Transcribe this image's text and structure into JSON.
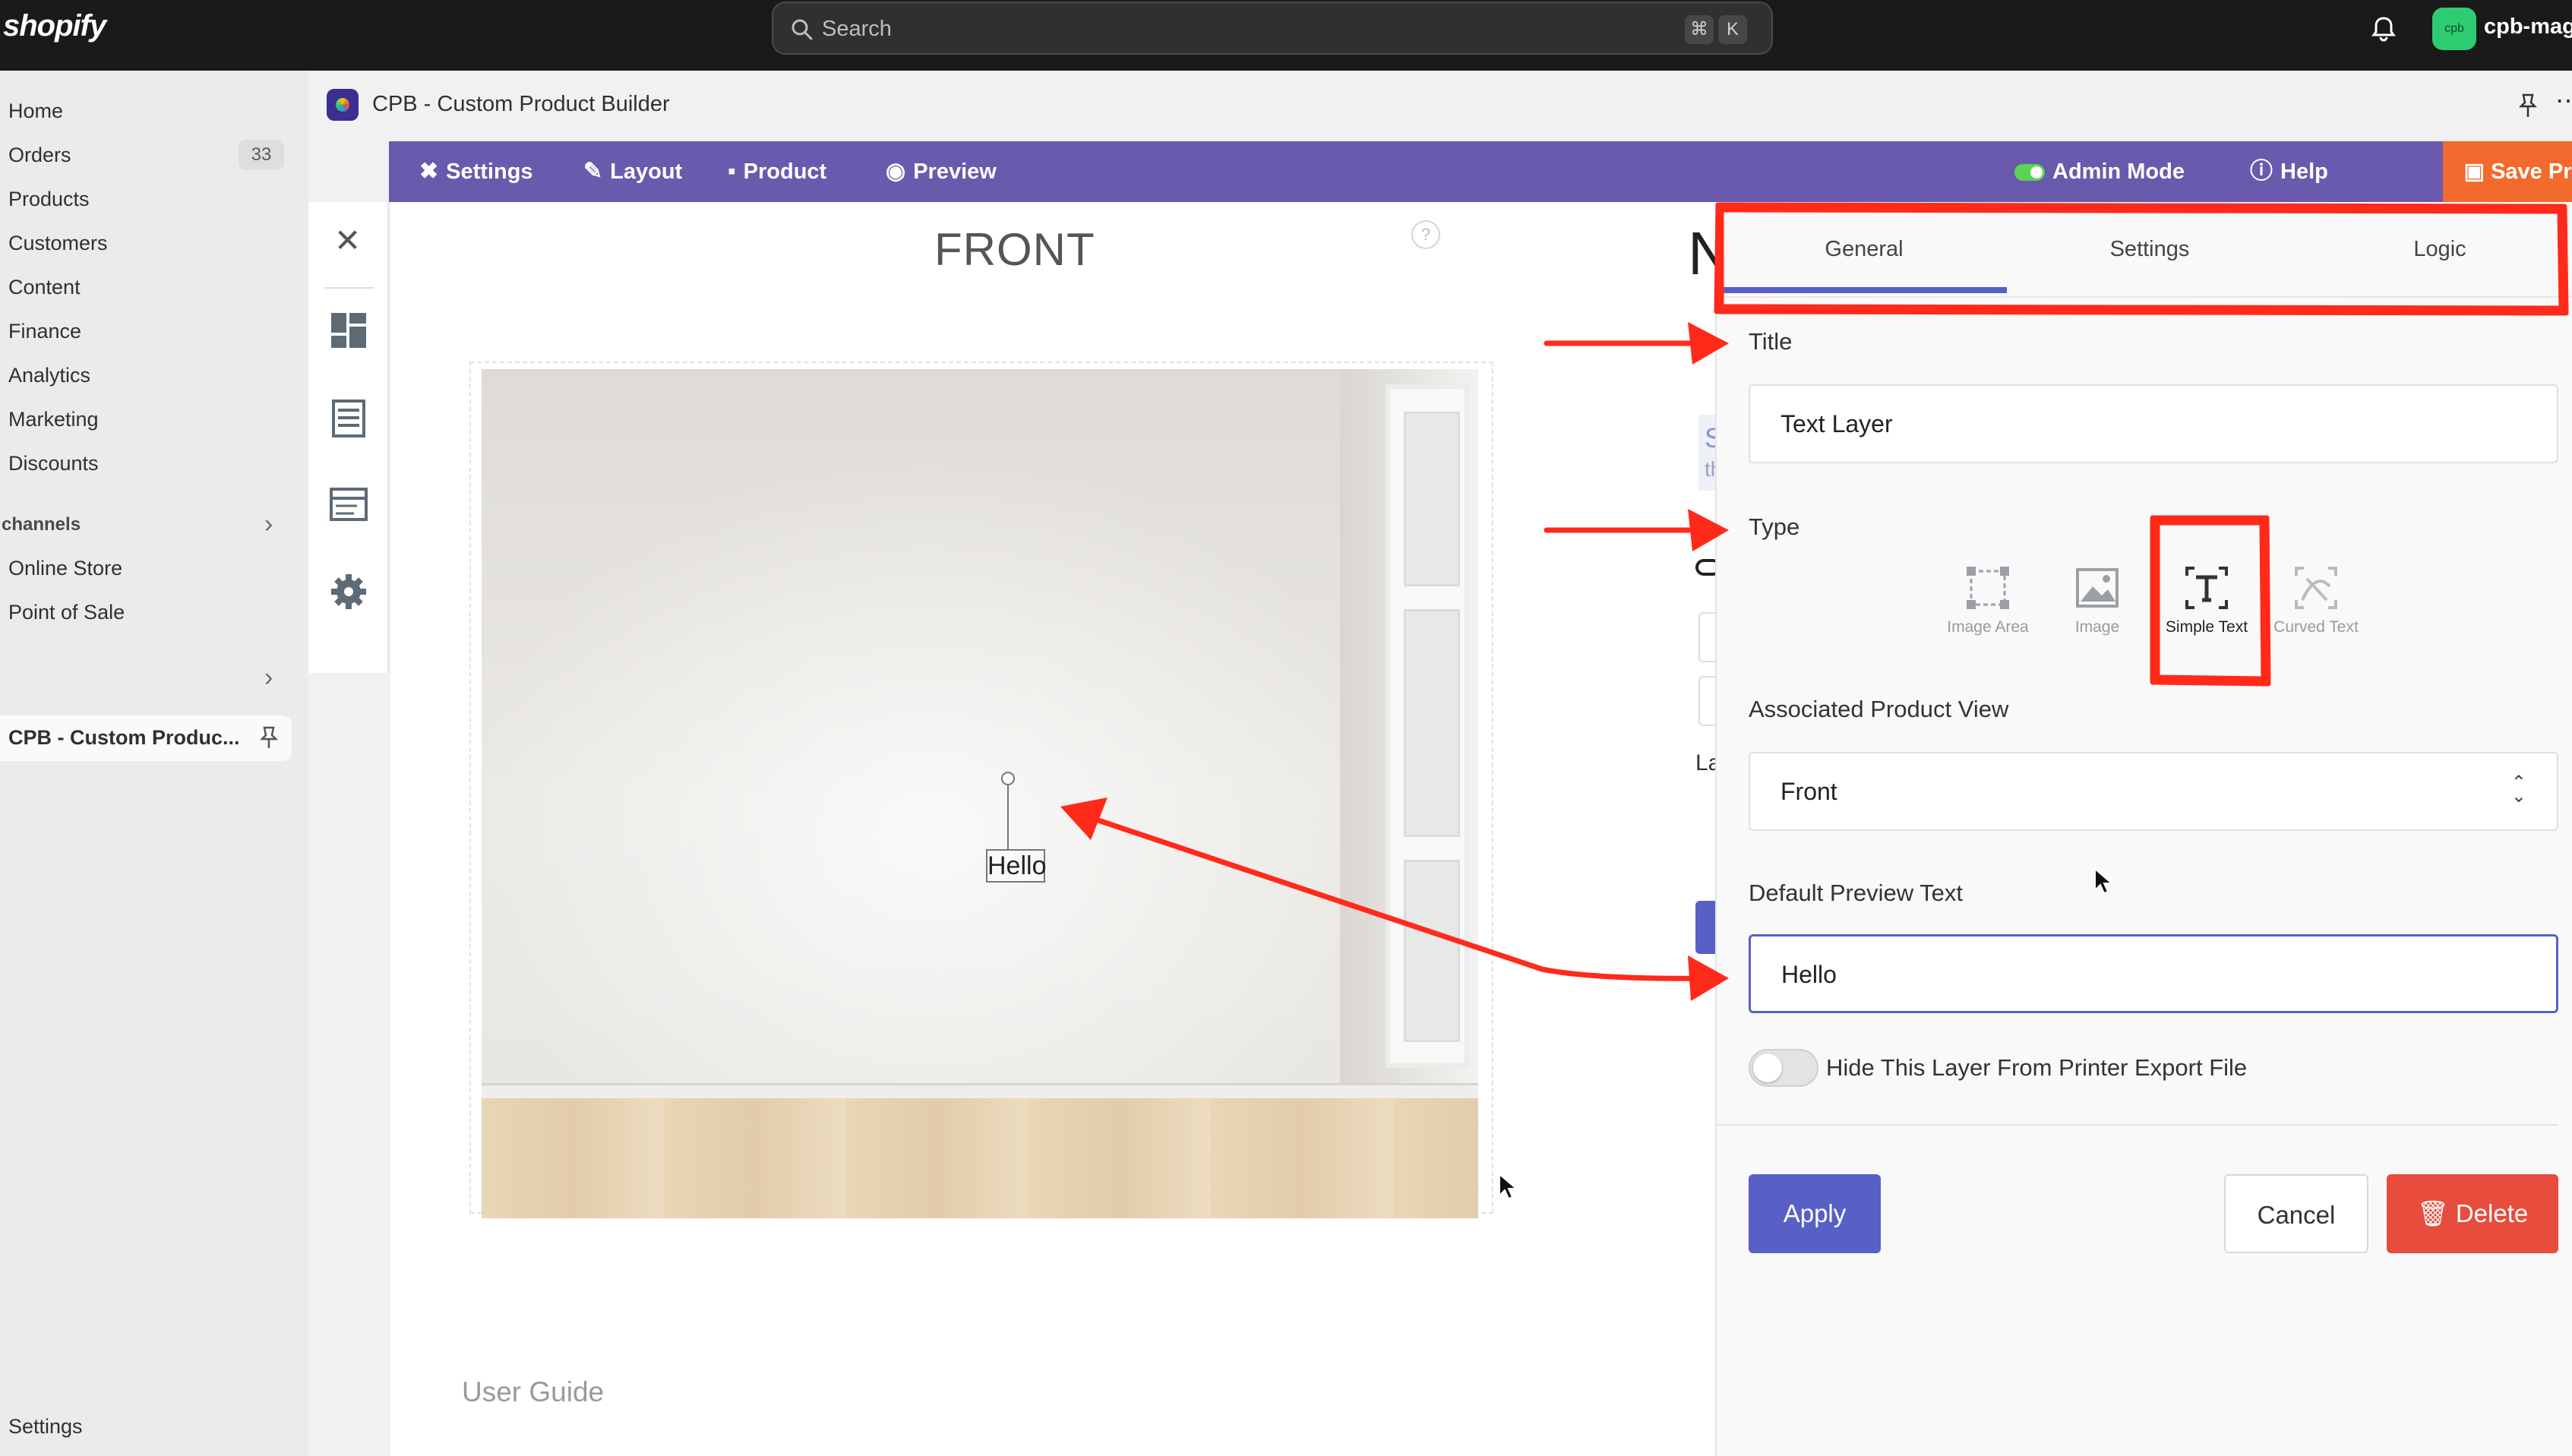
{
  "topbar": {
    "logo": "shopify",
    "search_placeholder": "Search",
    "shortcut_keys": [
      "⌘",
      "K"
    ],
    "store_avatar": "cpb",
    "store_name": "cpb-mago"
  },
  "nav": {
    "items": [
      {
        "label": "Home"
      },
      {
        "label": "Orders",
        "badge": "33"
      },
      {
        "label": "Products"
      },
      {
        "label": "Customers"
      },
      {
        "label": "Content"
      },
      {
        "label": "Finance"
      },
      {
        "label": "Analytics"
      },
      {
        "label": "Marketing"
      },
      {
        "label": "Discounts"
      }
    ],
    "channels_heading": "channels",
    "channel_items": [
      {
        "label": "Online Store"
      },
      {
        "label": "Point of Sale"
      }
    ],
    "app_item": "CPB - Custom Produc...",
    "settings": "Settings"
  },
  "app": {
    "title": "CPB - Custom Product Builder",
    "toolbar": {
      "settings": "Settings",
      "layout": "Layout",
      "product": "Product",
      "preview": "Preview",
      "admin_mode": "Admin Mode",
      "help": "Help",
      "save": "Save Product"
    }
  },
  "canvas": {
    "view_label": "FRONT",
    "help_glyph": "?",
    "text_layer_content": "Hello",
    "user_guide": "User Guide",
    "behind_letter": "N",
    "behind_fragments": [
      "S",
      "th",
      "La"
    ]
  },
  "panel": {
    "tabs": [
      "General",
      "Settings",
      "Logic"
    ],
    "active_tab": "General",
    "title_label": "Title",
    "title_value": "Text Layer",
    "type_label": "Type",
    "type_options": [
      "Image Area",
      "Image",
      "Simple Text",
      "Curved Text"
    ],
    "selected_type": "Simple Text",
    "product_view_label": "Associated Product View",
    "product_view_value": "Front",
    "preview_text_label": "Default Preview Text",
    "preview_text_value": "Hello",
    "hide_layer_label": "Hide This Layer From Printer Export File",
    "hide_layer_enabled": false,
    "apply": "Apply",
    "cancel": "Cancel",
    "delete": "Delete"
  },
  "colors": {
    "toolbar": "#6a5aad",
    "save_button": "#f26a2e",
    "accent": "#5860c5",
    "delete": "#e74c3c",
    "annotation": "#ff2a1a"
  }
}
